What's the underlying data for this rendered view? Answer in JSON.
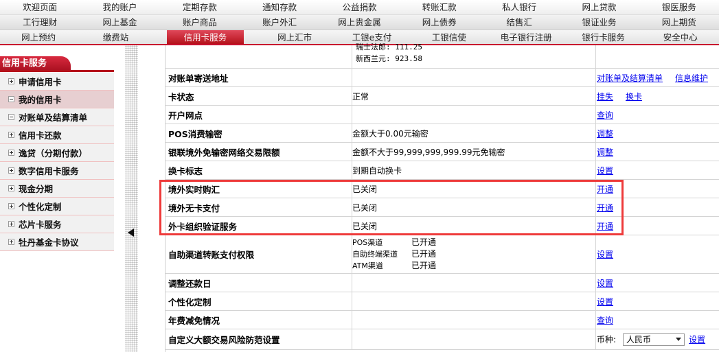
{
  "menu": {
    "row1": [
      "欢迎页面",
      "我的账户",
      "定期存款",
      "通知存款",
      "公益捐款",
      "转账汇款",
      "私人银行",
      "网上贷款",
      "银医服务"
    ],
    "row2": [
      "工行理财",
      "网上基金",
      "账户商品",
      "账户外汇",
      "网上贵金属",
      "网上债券",
      "结售汇",
      "银证业务",
      "网上期货"
    ],
    "row3": [
      "网上预约",
      "缴费站",
      "信用卡服务",
      "网上汇市",
      "工银e支付",
      "工银信使",
      "电子银行注册",
      "银行卡服务",
      "安全中心"
    ],
    "row3_active_index": 2
  },
  "sidebar": {
    "title": "信用卡服务",
    "items": [
      {
        "label": "申请信用卡",
        "expanded": false
      },
      {
        "label": "我的信用卡",
        "expanded": true,
        "selected": true
      },
      {
        "label": "对账单及结算清单",
        "expanded": true
      },
      {
        "label": "信用卡还款",
        "expanded": false
      },
      {
        "label": "逸贷（分期付款）",
        "expanded": false
      },
      {
        "label": "数字信用卡服务",
        "expanded": false
      },
      {
        "label": "现金分期",
        "expanded": false
      },
      {
        "label": "个性化定制",
        "expanded": false
      },
      {
        "label": "芯片卡服务",
        "expanded": false
      },
      {
        "label": "牡丹基金卡协议",
        "expanded": false
      }
    ]
  },
  "currency_partial": {
    "line1": "瑞士法郎: 111.25",
    "line2": "新西兰元: 923.58"
  },
  "rows": [
    {
      "label": "对账单寄送地址",
      "value": "",
      "actions": [
        "对账单及结算清单",
        "信息维护"
      ]
    },
    {
      "label": "卡状态",
      "value": "正常",
      "actions": [
        "挂失",
        "换卡"
      ]
    },
    {
      "label": "开户网点",
      "value": "",
      "actions": [
        "查询"
      ]
    },
    {
      "label": "POS消费输密",
      "value": "金额大于0.00元输密",
      "actions": [
        "调整"
      ]
    },
    {
      "label": "银联境外免输密网络交易限额",
      "value": "金额不大于99,999,999,999.99元免输密",
      "actions": [
        "调整"
      ]
    },
    {
      "label": "换卡标志",
      "value": "到期自动换卡",
      "actions": [
        "设置"
      ]
    },
    {
      "label": "境外实时购汇",
      "value": "已关闭",
      "actions": [
        "开通"
      ]
    },
    {
      "label": "境外无卡支付",
      "value": "已关闭",
      "actions": [
        "开通"
      ]
    },
    {
      "label": "外卡组织验证服务",
      "value": "已关闭",
      "actions": [
        "开通"
      ]
    },
    {
      "label": "自助渠道转账支付权限",
      "channels": [
        {
          "name": "POS渠道",
          "status": "已开通"
        },
        {
          "name": "自助终端渠道",
          "status": "已开通"
        },
        {
          "name": "ATM渠道",
          "status": "已开通"
        }
      ],
      "actions": [
        "设置"
      ]
    },
    {
      "label": "调整还款日",
      "value": "",
      "actions": [
        "设置"
      ]
    },
    {
      "label": "个性化定制",
      "value": "",
      "actions": [
        "设置"
      ]
    },
    {
      "label": "年费减免情况",
      "value": "",
      "actions": [
        "查询"
      ]
    },
    {
      "label": "自定义大额交易风险防范设置",
      "value": "",
      "currency_label": "币种:",
      "currency_selected": "人民币",
      "actions": [
        "设置"
      ]
    }
  ]
}
